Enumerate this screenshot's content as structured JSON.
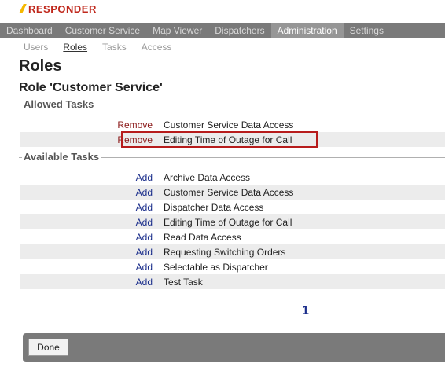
{
  "brand": {
    "name": "RESPONDER"
  },
  "top_nav": {
    "tabs": [
      "Dashboard",
      "Customer Service",
      "Map Viewer",
      "Dispatchers",
      "Administration",
      "Settings"
    ],
    "active": "Administration"
  },
  "sub_nav": {
    "items": [
      "Users",
      "Roles",
      "Tasks",
      "Access"
    ],
    "active": "Roles"
  },
  "page": {
    "title": "Roles",
    "subtitle": "Role 'Customer Service'"
  },
  "allowed": {
    "label": "Allowed Tasks",
    "rows": [
      {
        "action": "Remove",
        "task": "Customer Service Data Access"
      },
      {
        "action": "Remove",
        "task": "Editing Time of Outage for Call"
      }
    ]
  },
  "available": {
    "label": "Available Tasks",
    "rows": [
      {
        "action": "Add",
        "task": "Archive Data Access"
      },
      {
        "action": "Add",
        "task": "Customer Service Data Access"
      },
      {
        "action": "Add",
        "task": "Dispatcher Data Access"
      },
      {
        "action": "Add",
        "task": "Editing Time of Outage for Call"
      },
      {
        "action": "Add",
        "task": "Read Data Access"
      },
      {
        "action": "Add",
        "task": "Requesting Switching Orders"
      },
      {
        "action": "Add",
        "task": "Selectable as Dispatcher"
      },
      {
        "action": "Add",
        "task": "Test Task"
      }
    ]
  },
  "pagination": {
    "current": "1"
  },
  "footer": {
    "done_label": "Done"
  },
  "colors": {
    "brand_red": "#c0281c",
    "nav_gray": "#7a7a7a",
    "remove_link": "#8b1a1a",
    "add_link": "#1a2d8b",
    "highlight_box": "#b71c1c"
  }
}
